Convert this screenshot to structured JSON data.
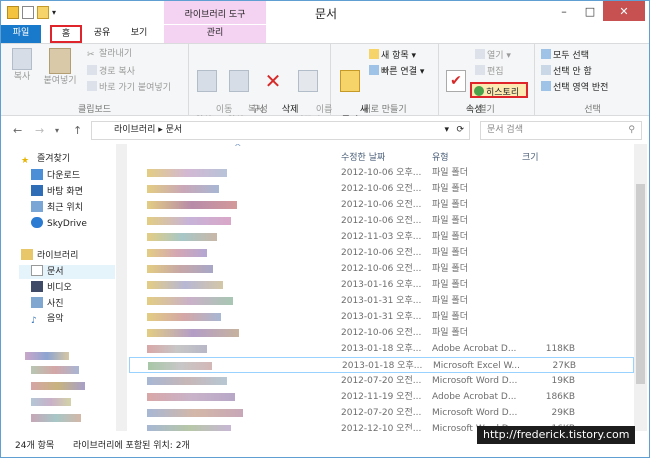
{
  "window": {
    "title": "문서",
    "minimize": "–",
    "maximize": "□",
    "close": "✕"
  },
  "ribbon_tabs": {
    "file": "파일",
    "home": "홈",
    "share": "공유",
    "view": "보기",
    "context_header": "라이브러리 도구",
    "manage": "관리"
  },
  "clipboard": {
    "copy": "복사",
    "paste": "붙여넣기",
    "cut": "잘라내기",
    "copy_path": "경로 복사",
    "paste_shortcut": "바로 가기 붙여넣기",
    "label": "클립보드"
  },
  "organize": {
    "move_to": "이동\n위치 ▾",
    "copy_to": "복사\n위치 ▾",
    "delete": "삭제\n▾",
    "rename": "이름\n바꾸기",
    "label": "구성"
  },
  "new": {
    "new_folder": "새\n폴더",
    "new_item": "새 항목 ▾",
    "easy_access": "빠른 연결 ▾",
    "label": "새로 만들기"
  },
  "open": {
    "properties": "속성\n▾",
    "open": "열기 ▾",
    "edit": "편집",
    "history": "히스토리",
    "label": "열기"
  },
  "select": {
    "select_all": "모두 선택",
    "select_none": "선택 안 함",
    "invert": "선택 영역 반전",
    "label": "선택"
  },
  "address": {
    "path": "라이브러리 ▸ 문서",
    "search_placeholder": "문서 검색",
    "back": "←",
    "forward": "→",
    "up": "↑"
  },
  "nav": {
    "favorites": "즐겨찾기",
    "downloads": "다운로드",
    "desktop": "바탕 화면",
    "recent": "최근 위치",
    "skydrive": "SkyDrive",
    "libraries": "라이브러리",
    "documents": "문서",
    "videos": "비디오",
    "pictures": "사진",
    "music": "음악"
  },
  "columns": {
    "date": "수정한 날짜",
    "type": "유형",
    "size": "크기"
  },
  "rows": [
    {
      "date": "2012-10-06 오후...",
      "type": "파일 폴더",
      "size": ""
    },
    {
      "date": "2012-10-06 오전...",
      "type": "파일 폴더",
      "size": ""
    },
    {
      "date": "2012-10-06 오전...",
      "type": "파일 폴더",
      "size": ""
    },
    {
      "date": "2012-10-06 오전...",
      "type": "파일 폴더",
      "size": ""
    },
    {
      "date": "2012-11-03 오후...",
      "type": "파일 폴더",
      "size": ""
    },
    {
      "date": "2012-10-06 오전...",
      "type": "파일 폴더",
      "size": ""
    },
    {
      "date": "2012-10-06 오전...",
      "type": "파일 폴더",
      "size": ""
    },
    {
      "date": "2013-01-16 오후...",
      "type": "파일 폴더",
      "size": ""
    },
    {
      "date": "2013-01-31 오후...",
      "type": "파일 폴더",
      "size": ""
    },
    {
      "date": "2013-01-31 오후...",
      "type": "파일 폴더",
      "size": ""
    },
    {
      "date": "2012-10-06 오전...",
      "type": "파일 폴더",
      "size": ""
    },
    {
      "date": "2013-01-18 오후...",
      "type": "Adobe Acrobat D...",
      "size": "118KB"
    },
    {
      "date": "2013-01-18 오후...",
      "type": "Microsoft Excel W...",
      "size": "27KB"
    },
    {
      "date": "2012-07-20 오전...",
      "type": "Microsoft Word D...",
      "size": "19KB"
    },
    {
      "date": "2012-11-19 오전...",
      "type": "Adobe Acrobat D...",
      "size": "186KB"
    },
    {
      "date": "2012-07-20 오전...",
      "type": "Microsoft Word D...",
      "size": "29KB"
    },
    {
      "date": "2012-12-10 오전...",
      "type": "Microsoft Word D...",
      "size": "16KB"
    }
  ],
  "status": {
    "count": "24개 항목",
    "library_info": "라이브러리에 포함된 위치: 2개"
  },
  "watermark": "http://frederick.tistory.com",
  "colors": {
    "accent": "#1979ca",
    "highlight_border": "#e0242b",
    "context_tab": "#f4d2f2",
    "selection": "#99d1ff"
  }
}
